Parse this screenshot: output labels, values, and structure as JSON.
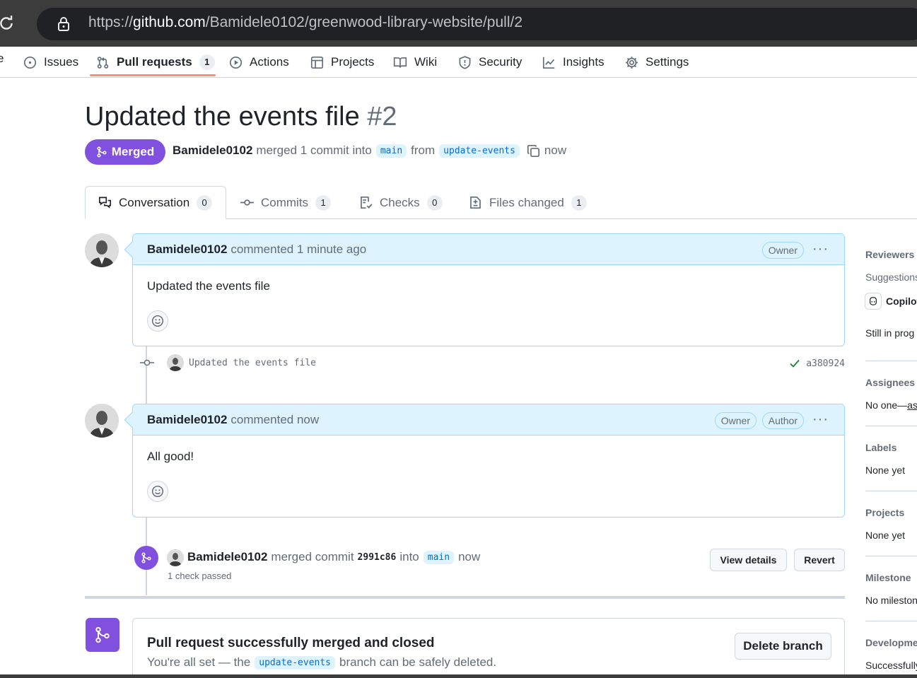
{
  "browser": {
    "url_prefix": "https://",
    "url_host": "github.com",
    "url_path": "/Bamidele0102/greenwood-library-website/pull/2"
  },
  "repo_nav": {
    "cut_item": "e",
    "items": [
      {
        "label": "Issues",
        "icon": "issue-icon"
      },
      {
        "label": "Pull requests",
        "icon": "pull-request-icon",
        "count": "1",
        "active": true
      },
      {
        "label": "Actions",
        "icon": "play-icon"
      },
      {
        "label": "Projects",
        "icon": "table-icon"
      },
      {
        "label": "Wiki",
        "icon": "book-icon"
      },
      {
        "label": "Security",
        "icon": "shield-icon"
      },
      {
        "label": "Insights",
        "icon": "graph-icon"
      },
      {
        "label": "Settings",
        "icon": "gear-icon"
      }
    ]
  },
  "pr": {
    "title": "Updated the events file",
    "number": "#2",
    "state": "Merged",
    "author": "Bamidele0102",
    "merge_text": "merged 1 commit into",
    "base_branch": "main",
    "from_text": "from",
    "head_branch": "update-events",
    "time": "now"
  },
  "tabs": [
    {
      "label": "Conversation",
      "count": "0",
      "icon": "comment-discussion-icon"
    },
    {
      "label": "Commits",
      "count": "1",
      "icon": "commit-icon"
    },
    {
      "label": "Checks",
      "count": "0",
      "icon": "checklist-icon"
    },
    {
      "label": "Files changed",
      "count": "1",
      "icon": "file-diff-icon"
    }
  ],
  "comments": [
    {
      "author": "Bamidele0102",
      "action": "commented 1 minute ago",
      "labels": [
        "Owner"
      ],
      "body": "Updated the events file",
      "more": "···"
    },
    {
      "author": "Bamidele0102",
      "action": "commented now",
      "labels": [
        "Owner",
        "Author"
      ],
      "body": "All good!",
      "more": "···"
    }
  ],
  "commit": {
    "message": "Updated the events file",
    "sha": "a380924",
    "status": "success"
  },
  "merge_event": {
    "author": "Bamidele0102",
    "text": "merged commit",
    "sha": "2991c86",
    "into": "into",
    "branch": "main",
    "time": "now",
    "checks": "1 check passed",
    "view_details": "View details",
    "revert": "Revert"
  },
  "merged_box": {
    "title": "Pull request successfully merged and closed",
    "sub_prefix": "You're all set — the",
    "branch": "update-events",
    "sub_suffix": "branch can be safely deleted.",
    "delete_button": "Delete branch"
  },
  "sidebar": {
    "reviewers": {
      "heading": "Reviewers",
      "suggestions": "Suggestions",
      "copilot": "Copilot",
      "status": "Still in prog"
    },
    "assignees": {
      "heading": "Assignees",
      "value": "No one—",
      "link": "as"
    },
    "labels": {
      "heading": "Labels",
      "value": "None yet"
    },
    "projects": {
      "heading": "Projects",
      "value": "None yet"
    },
    "milestone": {
      "heading": "Milestone",
      "value": "No milestone"
    },
    "development": {
      "heading": "Development",
      "value": "Successfully"
    }
  },
  "colors": {
    "merged_purple": "#8250df",
    "comment_header_bg": "#ddf4ff",
    "comment_border": "#9cd7ff",
    "active_tab_underline": "#fd8c73",
    "success_green": "#1a7f37"
  }
}
